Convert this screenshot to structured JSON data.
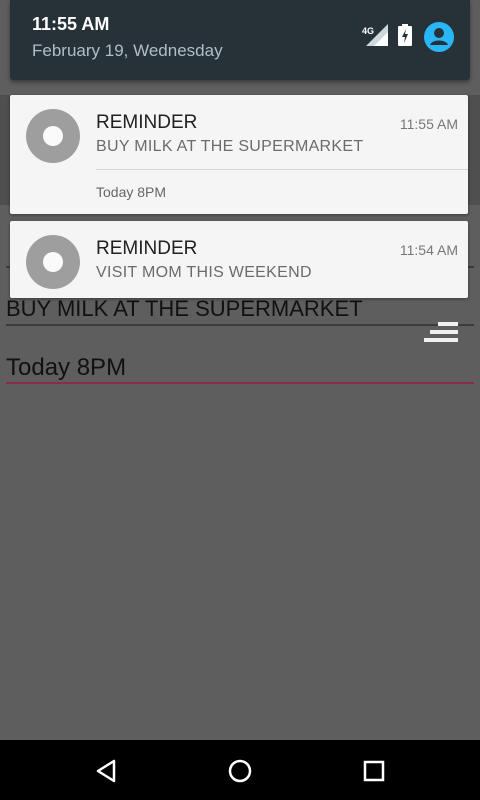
{
  "status": {
    "time": "11:55 AM",
    "date": "February 19, Wednesday",
    "network_label": "4G"
  },
  "notifications": [
    {
      "title": "REMINDER",
      "message": "BUY MILK AT THE SUPERMARKET",
      "time": "11:55 AM",
      "subtext": "Today 8PM"
    },
    {
      "title": "REMINDER",
      "message": "VISIT MOM THIS WEEKEND",
      "time": "11:54 AM"
    }
  ],
  "background_form": {
    "title_value": "BUY MILK AT THE SUPERMARKET",
    "time_value": "Today 8PM"
  },
  "icons": {
    "status": [
      "signal-4g-icon",
      "battery-charging-icon",
      "user-account-icon"
    ],
    "notification": "reminder-ring-icon",
    "app": "sort-icon",
    "nav": [
      "back-icon",
      "home-icon",
      "recents-icon"
    ]
  },
  "colors": {
    "shade_header": "#263238",
    "accent_user": "#29b6f6",
    "field_underline_active": "#8b2a4e"
  }
}
